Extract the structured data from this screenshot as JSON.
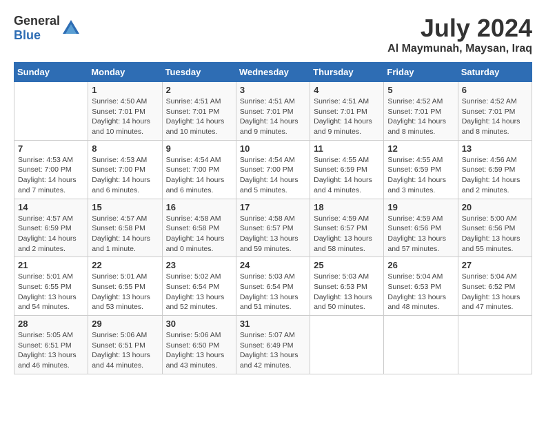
{
  "header": {
    "logo_general": "General",
    "logo_blue": "Blue",
    "month_year": "July 2024",
    "location": "Al Maymunah, Maysan, Iraq"
  },
  "columns": [
    "Sunday",
    "Monday",
    "Tuesday",
    "Wednesday",
    "Thursday",
    "Friday",
    "Saturday"
  ],
  "weeks": [
    [
      {
        "day": "",
        "info": ""
      },
      {
        "day": "1",
        "info": "Sunrise: 4:50 AM\nSunset: 7:01 PM\nDaylight: 14 hours\nand 10 minutes."
      },
      {
        "day": "2",
        "info": "Sunrise: 4:51 AM\nSunset: 7:01 PM\nDaylight: 14 hours\nand 10 minutes."
      },
      {
        "day": "3",
        "info": "Sunrise: 4:51 AM\nSunset: 7:01 PM\nDaylight: 14 hours\nand 9 minutes."
      },
      {
        "day": "4",
        "info": "Sunrise: 4:51 AM\nSunset: 7:01 PM\nDaylight: 14 hours\nand 9 minutes."
      },
      {
        "day": "5",
        "info": "Sunrise: 4:52 AM\nSunset: 7:01 PM\nDaylight: 14 hours\nand 8 minutes."
      },
      {
        "day": "6",
        "info": "Sunrise: 4:52 AM\nSunset: 7:01 PM\nDaylight: 14 hours\nand 8 minutes."
      }
    ],
    [
      {
        "day": "7",
        "info": "Sunrise: 4:53 AM\nSunset: 7:00 PM\nDaylight: 14 hours\nand 7 minutes."
      },
      {
        "day": "8",
        "info": "Sunrise: 4:53 AM\nSunset: 7:00 PM\nDaylight: 14 hours\nand 6 minutes."
      },
      {
        "day": "9",
        "info": "Sunrise: 4:54 AM\nSunset: 7:00 PM\nDaylight: 14 hours\nand 6 minutes."
      },
      {
        "day": "10",
        "info": "Sunrise: 4:54 AM\nSunset: 7:00 PM\nDaylight: 14 hours\nand 5 minutes."
      },
      {
        "day": "11",
        "info": "Sunrise: 4:55 AM\nSunset: 6:59 PM\nDaylight: 14 hours\nand 4 minutes."
      },
      {
        "day": "12",
        "info": "Sunrise: 4:55 AM\nSunset: 6:59 PM\nDaylight: 14 hours\nand 3 minutes."
      },
      {
        "day": "13",
        "info": "Sunrise: 4:56 AM\nSunset: 6:59 PM\nDaylight: 14 hours\nand 2 minutes."
      }
    ],
    [
      {
        "day": "14",
        "info": "Sunrise: 4:57 AM\nSunset: 6:59 PM\nDaylight: 14 hours\nand 2 minutes."
      },
      {
        "day": "15",
        "info": "Sunrise: 4:57 AM\nSunset: 6:58 PM\nDaylight: 14 hours\nand 1 minute."
      },
      {
        "day": "16",
        "info": "Sunrise: 4:58 AM\nSunset: 6:58 PM\nDaylight: 14 hours\nand 0 minutes."
      },
      {
        "day": "17",
        "info": "Sunrise: 4:58 AM\nSunset: 6:57 PM\nDaylight: 13 hours\nand 59 minutes."
      },
      {
        "day": "18",
        "info": "Sunrise: 4:59 AM\nSunset: 6:57 PM\nDaylight: 13 hours\nand 58 minutes."
      },
      {
        "day": "19",
        "info": "Sunrise: 4:59 AM\nSunset: 6:56 PM\nDaylight: 13 hours\nand 57 minutes."
      },
      {
        "day": "20",
        "info": "Sunrise: 5:00 AM\nSunset: 6:56 PM\nDaylight: 13 hours\nand 55 minutes."
      }
    ],
    [
      {
        "day": "21",
        "info": "Sunrise: 5:01 AM\nSunset: 6:55 PM\nDaylight: 13 hours\nand 54 minutes."
      },
      {
        "day": "22",
        "info": "Sunrise: 5:01 AM\nSunset: 6:55 PM\nDaylight: 13 hours\nand 53 minutes."
      },
      {
        "day": "23",
        "info": "Sunrise: 5:02 AM\nSunset: 6:54 PM\nDaylight: 13 hours\nand 52 minutes."
      },
      {
        "day": "24",
        "info": "Sunrise: 5:03 AM\nSunset: 6:54 PM\nDaylight: 13 hours\nand 51 minutes."
      },
      {
        "day": "25",
        "info": "Sunrise: 5:03 AM\nSunset: 6:53 PM\nDaylight: 13 hours\nand 50 minutes."
      },
      {
        "day": "26",
        "info": "Sunrise: 5:04 AM\nSunset: 6:53 PM\nDaylight: 13 hours\nand 48 minutes."
      },
      {
        "day": "27",
        "info": "Sunrise: 5:04 AM\nSunset: 6:52 PM\nDaylight: 13 hours\nand 47 minutes."
      }
    ],
    [
      {
        "day": "28",
        "info": "Sunrise: 5:05 AM\nSunset: 6:51 PM\nDaylight: 13 hours\nand 46 minutes."
      },
      {
        "day": "29",
        "info": "Sunrise: 5:06 AM\nSunset: 6:51 PM\nDaylight: 13 hours\nand 44 minutes."
      },
      {
        "day": "30",
        "info": "Sunrise: 5:06 AM\nSunset: 6:50 PM\nDaylight: 13 hours\nand 43 minutes."
      },
      {
        "day": "31",
        "info": "Sunrise: 5:07 AM\nSunset: 6:49 PM\nDaylight: 13 hours\nand 42 minutes."
      },
      {
        "day": "",
        "info": ""
      },
      {
        "day": "",
        "info": ""
      },
      {
        "day": "",
        "info": ""
      }
    ]
  ]
}
